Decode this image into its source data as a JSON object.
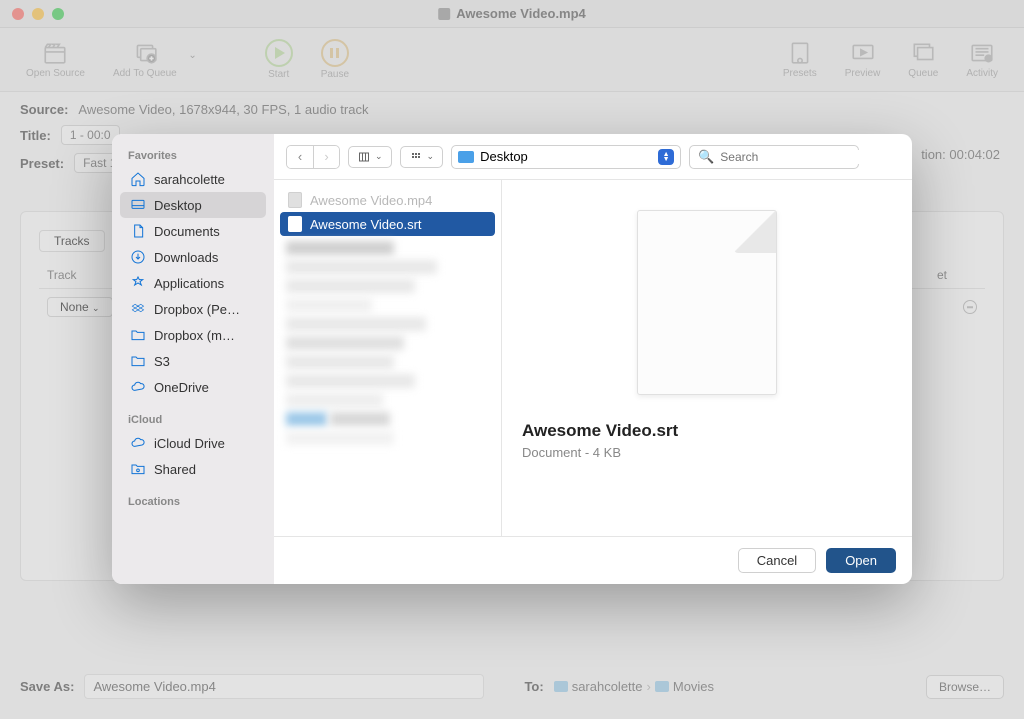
{
  "window": {
    "title": "Awesome Video.mp4"
  },
  "toolbar": {
    "open_source": "Open Source",
    "add_to_queue": "Add To Queue",
    "start": "Start",
    "pause": "Pause",
    "presets": "Presets",
    "preview": "Preview",
    "queue": "Queue",
    "activity": "Activity"
  },
  "source": {
    "label": "Source:",
    "value": "Awesome Video, 1678x944, 30 FPS, 1 audio track"
  },
  "title": {
    "label": "Title:",
    "value": "1 - 00:0"
  },
  "duration": {
    "suffix_label": "tion:",
    "value": "00:04:02"
  },
  "preset": {
    "label": "Preset:",
    "value": "Fast 1"
  },
  "tabs": {
    "tracks": "Tracks",
    "track_col": "Track",
    "et_col": "et",
    "none": "None"
  },
  "save_as": {
    "label": "Save As:",
    "value": "Awesome Video.mp4"
  },
  "to": {
    "label": "To:",
    "folder1": "sarahcolette",
    "folder2": "Movies"
  },
  "browse": "Browse…",
  "dialog": {
    "sidebar": {
      "favorites": "Favorites",
      "icloud": "iCloud",
      "locations": "Locations",
      "items": [
        {
          "label": "sarahcolette"
        },
        {
          "label": "Desktop"
        },
        {
          "label": "Documents"
        },
        {
          "label": "Downloads"
        },
        {
          "label": "Applications"
        },
        {
          "label": "Dropbox (Pe…"
        },
        {
          "label": "Dropbox (m…"
        },
        {
          "label": "S3"
        },
        {
          "label": "OneDrive"
        }
      ],
      "icloud_items": [
        {
          "label": "iCloud Drive"
        },
        {
          "label": "Shared"
        }
      ]
    },
    "location": "Desktop",
    "search_placeholder": "Search",
    "files": [
      {
        "name": "Awesome Video.mp4",
        "dim": true,
        "selected": false
      },
      {
        "name": "Awesome Video.srt",
        "dim": false,
        "selected": true
      }
    ],
    "preview": {
      "name": "Awesome Video.srt",
      "meta": "Document - 4 KB"
    },
    "cancel": "Cancel",
    "open": "Open"
  }
}
